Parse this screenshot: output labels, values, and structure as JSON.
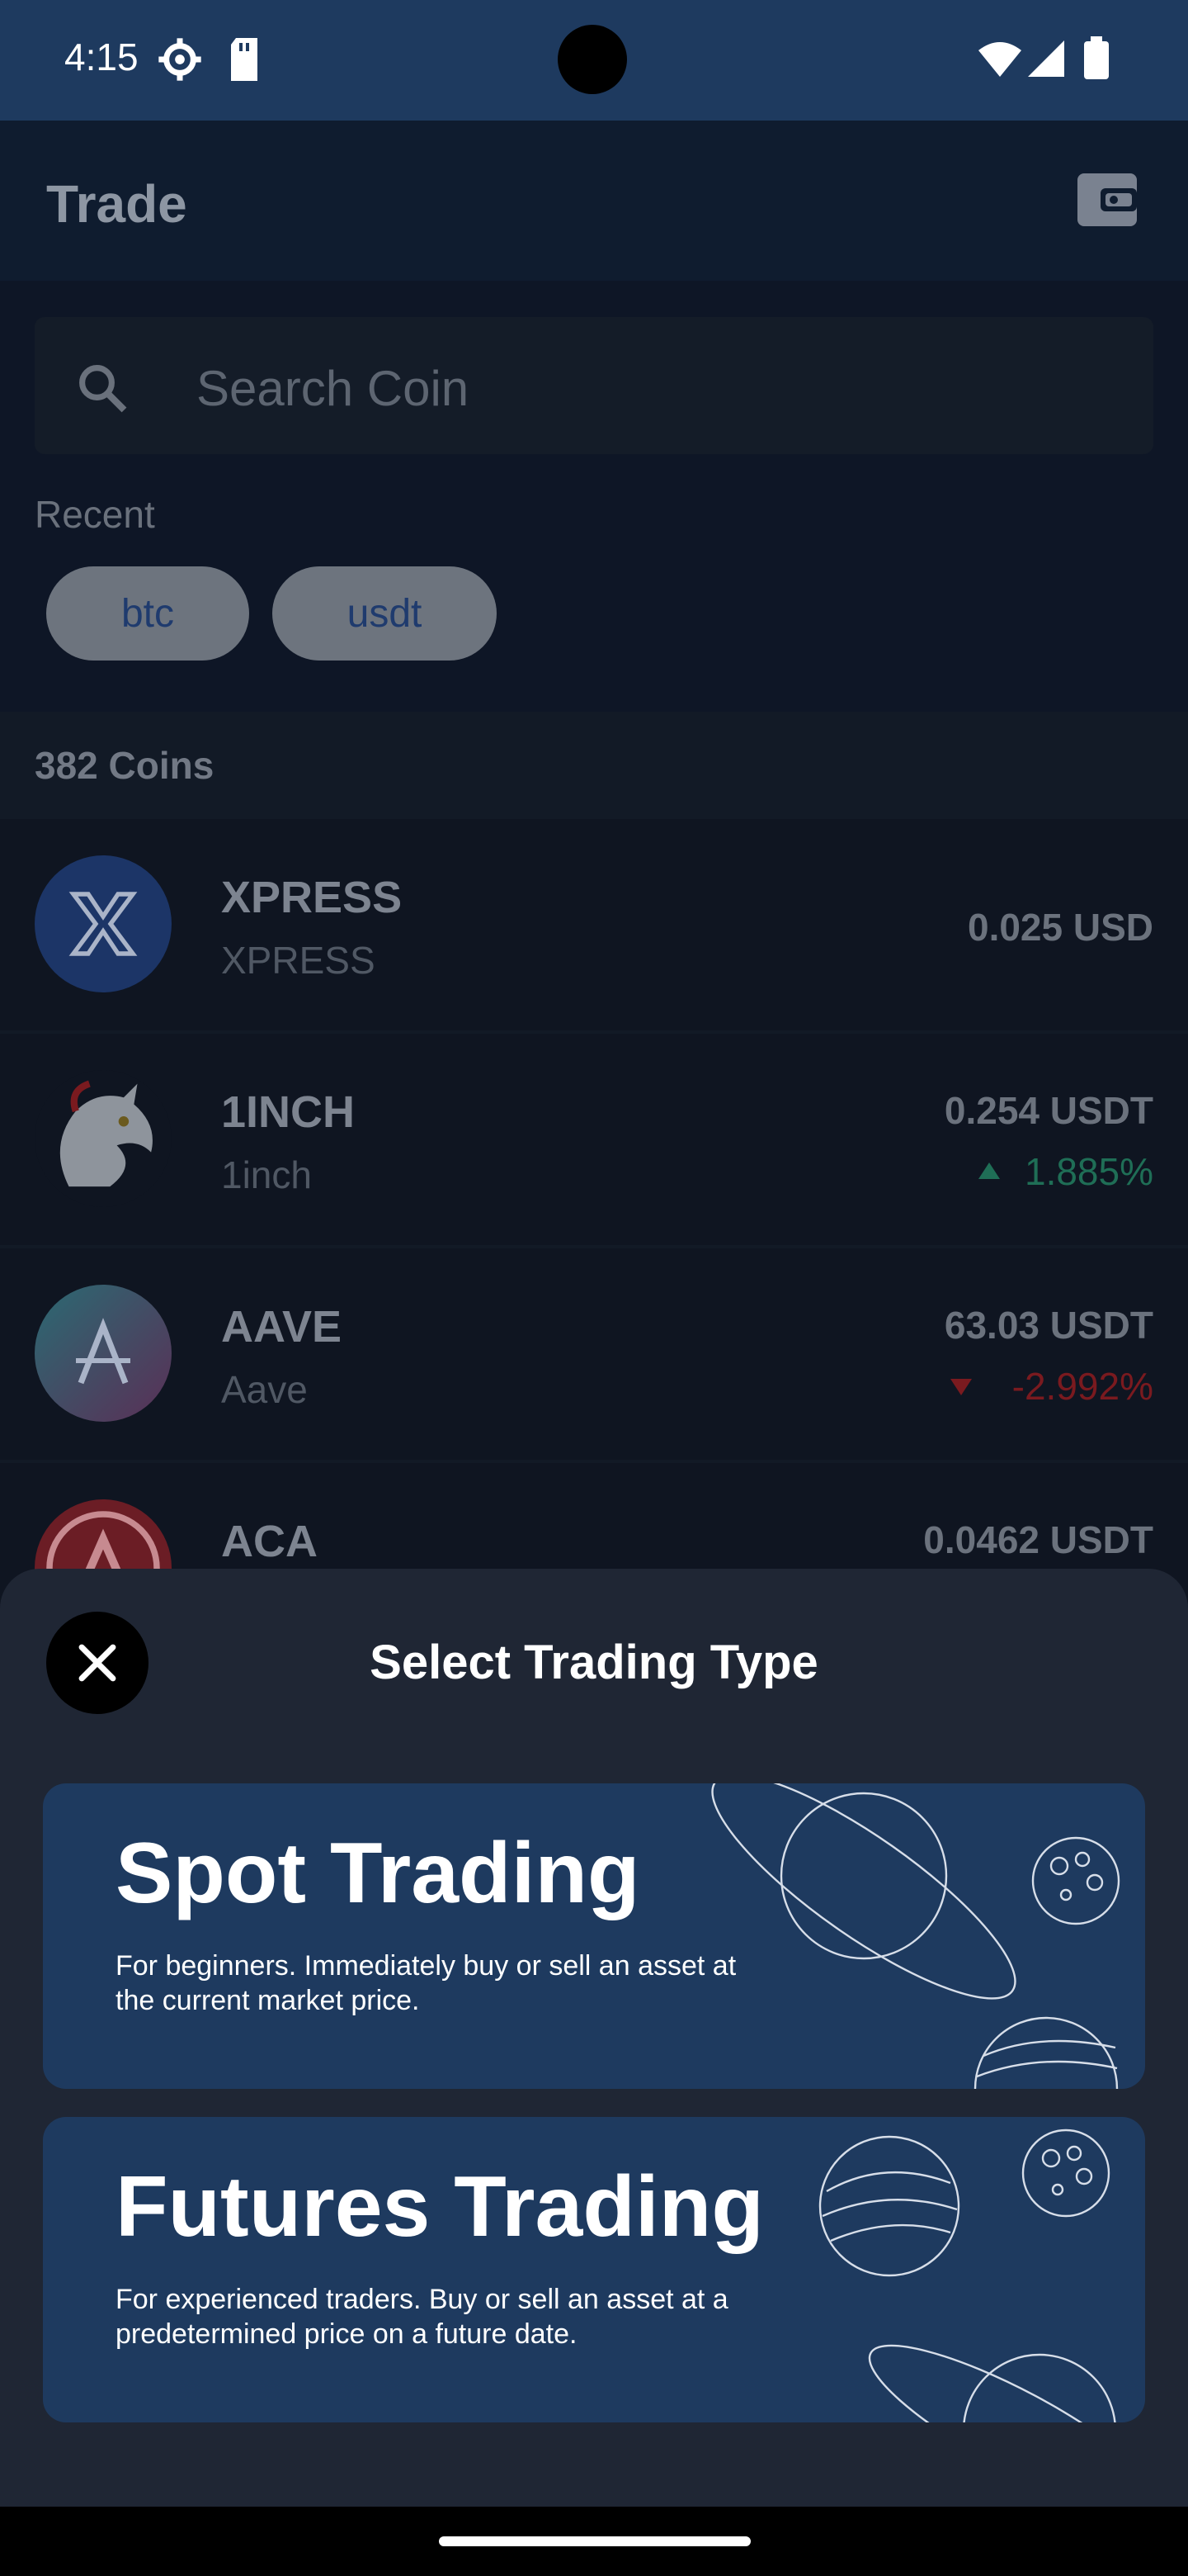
{
  "status_bar": {
    "time": "4:15"
  },
  "app_bar": {
    "title": "Trade"
  },
  "search": {
    "placeholder": "Search Coin"
  },
  "recent": {
    "label": "Recent",
    "chips": [
      "btc",
      "usdt"
    ]
  },
  "coins": {
    "count_label": "382 Coins",
    "items": [
      {
        "symbol": "XPRESS",
        "name": "XPRESS",
        "price": "0.025 USD",
        "change": ""
      },
      {
        "symbol": "1INCH",
        "name": "1inch",
        "price": "0.254 USDT",
        "change": "1.885%",
        "direction": "up"
      },
      {
        "symbol": "AAVE",
        "name": "Aave",
        "price": "63.03 USDT",
        "change": "-2.992%",
        "direction": "down"
      },
      {
        "symbol": "ACA",
        "name": "",
        "price": "0.0462 USDT",
        "change": ""
      }
    ]
  },
  "sheet": {
    "title": "Select Trading Type",
    "options": [
      {
        "title": "Spot Trading",
        "description": "For beginners. Immediately buy or sell an asset at the current market price."
      },
      {
        "title": "Futures Trading",
        "description": "For experienced traders. Buy or sell an asset at a predetermined price on a future date."
      }
    ]
  },
  "colors": {
    "card_bg": "#1e3a5f",
    "sheet_bg": "#1f2634",
    "up": "#1f6e56",
    "down": "#7a1a1f"
  }
}
